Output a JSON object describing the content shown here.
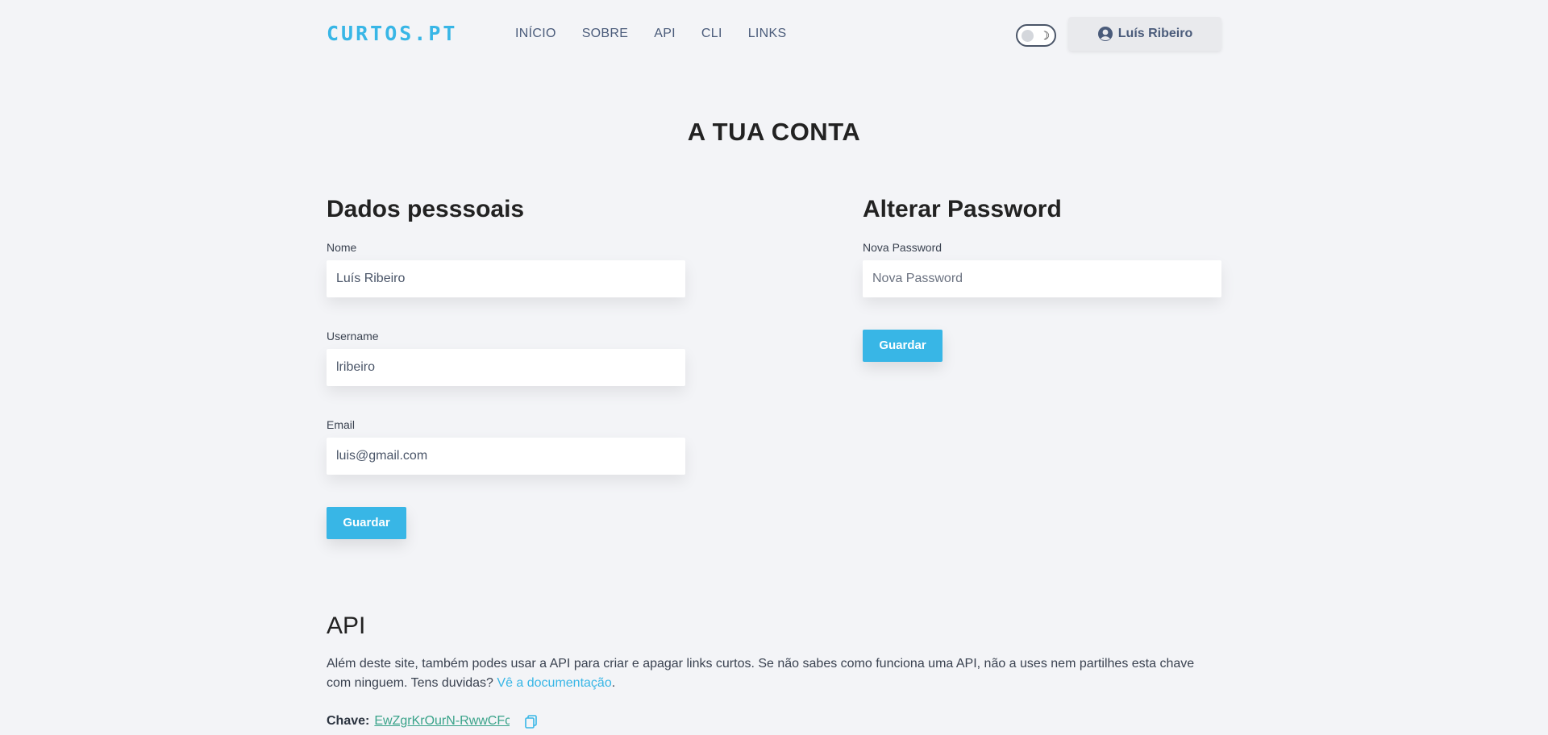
{
  "brand": {
    "logo": "CURTOS.PT",
    "accent": "#38b6e6"
  },
  "nav": {
    "items": [
      "INÍCIO",
      "SOBRE",
      "API",
      "CLI",
      "LINKS"
    ]
  },
  "header": {
    "user_name": "Luís Ribeiro"
  },
  "page": {
    "title": "A TUA CONTA"
  },
  "personal": {
    "heading": "Dados pesssoais",
    "name_label": "Nome",
    "name_value": "Luís Ribeiro",
    "username_label": "Username",
    "username_value": "lribeiro",
    "email_label": "Email",
    "email_value": "luis@gmail.com",
    "save_label": "Guardar"
  },
  "password": {
    "heading": "Alterar Password",
    "new_label": "Nova Password",
    "new_placeholder": "Nova Password",
    "save_label": "Guardar"
  },
  "api": {
    "heading": "API",
    "description": "Além deste site, também podes usar a API para criar e apagar links curtos. Se não sabes como funciona uma API, não a uses nem partilhes esta chave com ninguem. Tens duvidas? ",
    "docs_link": "Vê a documentação",
    "key_label": "Chave:",
    "key_value": "EwZgrKrOurN-RwwCFc"
  }
}
